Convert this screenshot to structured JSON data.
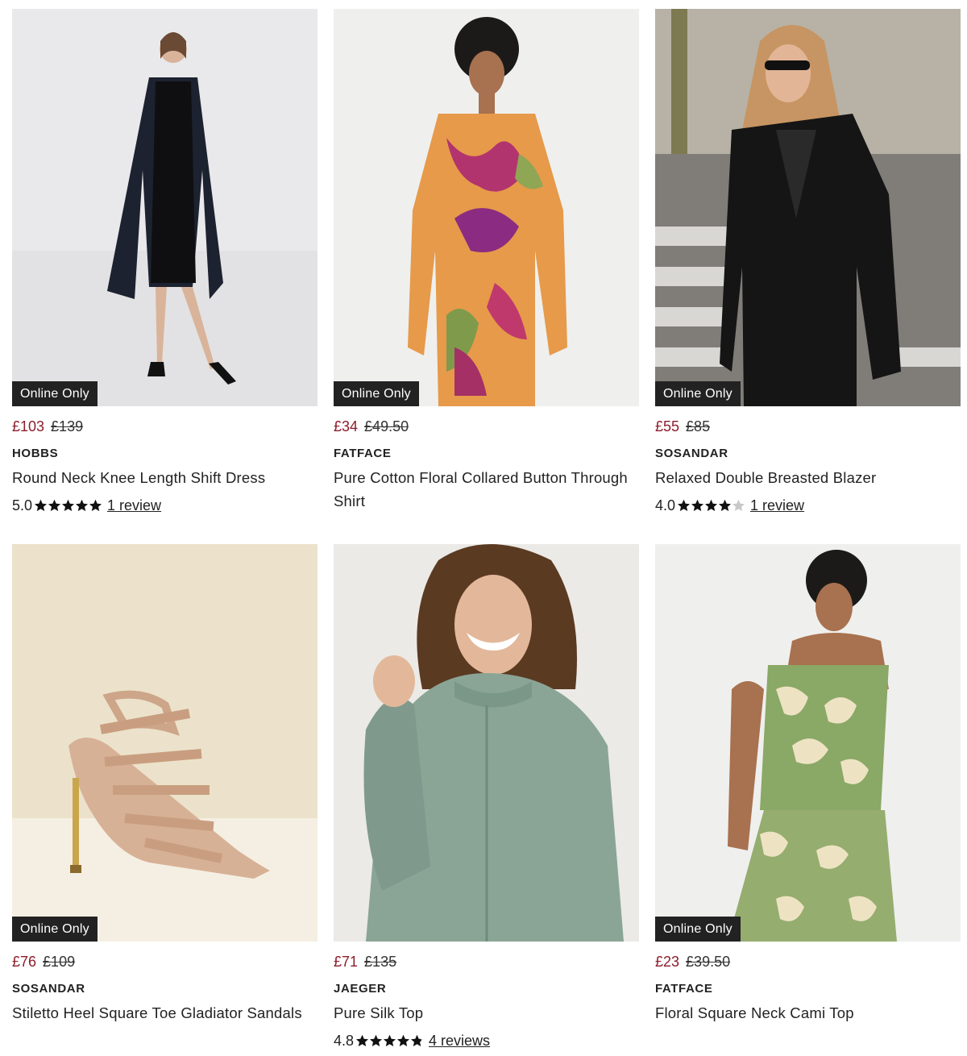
{
  "products": [
    {
      "badge": "Online Only",
      "price_now": "£103",
      "price_was": "£139",
      "brand": "HOBBS",
      "title": "Round Neck Knee Length Shift Dress",
      "rating_score": "5.0",
      "rating_value": 5,
      "review_text": "1 review",
      "image_icon": "model-in-black-coat-and-shift-dress"
    },
    {
      "badge": "Online Only",
      "price_now": "£34",
      "price_was": "£49.50",
      "brand": "FATFACE",
      "title": "Pure Cotton Floral Collared Button Through Shirt",
      "rating_score": null,
      "rating_value": null,
      "review_text": null,
      "image_icon": "model-in-floral-shirt"
    },
    {
      "badge": "Online Only",
      "price_now": "£55",
      "price_was": "£85",
      "brand": "SOSANDAR",
      "title": "Relaxed Double Breasted Blazer",
      "rating_score": "4.0",
      "rating_value": 4,
      "review_text": "1 review",
      "image_icon": "model-in-black-blazer"
    },
    {
      "badge": "Online Only",
      "price_now": "£76",
      "price_was": "£109",
      "brand": "SOSANDAR",
      "title": "Stiletto Heel Square Toe Gladiator Sandals",
      "rating_score": null,
      "rating_value": null,
      "review_text": null,
      "image_icon": "gladiator-sandal"
    },
    {
      "badge": null,
      "price_now": "£71",
      "price_was": "£135",
      "brand": "JAEGER",
      "title": "Pure Silk Top",
      "rating_score": "4.8",
      "rating_value": 4.8,
      "review_text": "4 reviews",
      "image_icon": "model-in-sage-silk-top"
    },
    {
      "badge": "Online Only",
      "price_now": "£23",
      "price_was": "£39.50",
      "brand": "FATFACE",
      "title": "Floral Square Neck Cami Top",
      "rating_score": null,
      "rating_value": null,
      "review_text": null,
      "image_icon": "model-in-green-floral-cami"
    }
  ],
  "colors": {
    "sale_price": "#8c1d2b",
    "badge_bg": "#222222",
    "star_fill": "#111111",
    "star_empty": "#c8c8c8"
  }
}
